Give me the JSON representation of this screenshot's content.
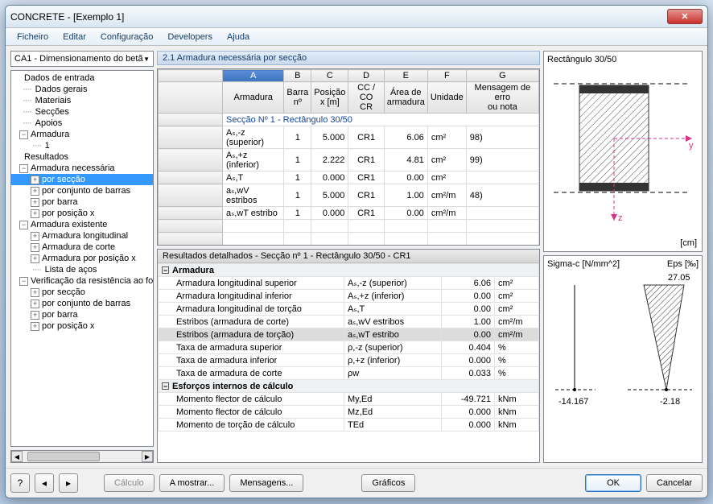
{
  "window_title": "CONCRETE - [Exemplo 1]",
  "menu": [
    "Ficheiro",
    "Editar",
    "Configuração",
    "Developers",
    "Ajuda"
  ],
  "dropdown": "CA1 - Dimensionamento do betã",
  "tree": {
    "n0": "Dados de entrada",
    "n1": "Dados gerais",
    "n2": "Materiais",
    "n3": "Secções",
    "n4": "Apoios",
    "n5": "Armadura",
    "n6": "1",
    "n7": "Resultados",
    "n8": "Armadura necessária",
    "n9": "por secção",
    "n10": "por conjunto de barras",
    "n11": "por barra",
    "n12": "por posição x",
    "n13": "Armadura existente",
    "n14": "Armadura longitudinal",
    "n15": "Armadura de corte",
    "n16": "Armadura por posição x",
    "n17": "Lista de aços",
    "n18": "Verificação da resistência ao fo",
    "n19": "por secção",
    "n20": "por conjunto de barras",
    "n21": "por barra",
    "n22": "por posição x"
  },
  "section_title": "2.1 Armadura necessária por secção",
  "cols": {
    "A": "A",
    "B": "B",
    "C": "C",
    "D": "D",
    "E": "E",
    "F": "F",
    "G": "G"
  },
  "heads": {
    "armadura": "Armadura",
    "barra": "Barra\nnº",
    "posx": "Posição\nx [m]",
    "ccco": "CC / CO\nCR",
    "area": "Área de\narmadura",
    "unid": "Unidade",
    "msg": "Mensagem de erro\nou nota"
  },
  "span_row": "Secção Nº 1 - Rectângulo 30/50",
  "grid_rows": [
    {
      "a": "Aₛ,-z (superior)",
      "b": "1",
      "c": "5.000",
      "d": "CR1",
      "e": "6.06",
      "f": "cm²",
      "g": "98)"
    },
    {
      "a": "Aₛ,+z (inferior)",
      "b": "1",
      "c": "2.222",
      "d": "CR1",
      "e": "4.81",
      "f": "cm²",
      "g": "99)"
    },
    {
      "a": "Aₛ,T",
      "b": "1",
      "c": "0.000",
      "d": "CR1",
      "e": "0.00",
      "f": "cm²",
      "g": ""
    },
    {
      "a": "aₛ,wV estribos",
      "b": "1",
      "c": "5.000",
      "d": "CR1",
      "e": "1.00",
      "f": "cm²/m",
      "g": "48)"
    },
    {
      "a": "aₛ,wT estribo",
      "b": "1",
      "c": "0.000",
      "d": "CR1",
      "e": "0.00",
      "f": "cm²/m",
      "g": ""
    }
  ],
  "detail_title": "Resultados detalhados  -  Secção nº 1 - Rectângulo 30/50  -  CR1",
  "detail": {
    "h1": "Armadura",
    "rows1": [
      {
        "l": "Armadura longitudinal superior",
        "s": "Aₛ,-z (superior)",
        "v": "6.06",
        "u": "cm²"
      },
      {
        "l": "Armadura longitudinal inferior",
        "s": "Aₛ,+z (inferior)",
        "v": "0.00",
        "u": "cm²"
      },
      {
        "l": "Armadura longitudinal de torção",
        "s": "Aₛ,T",
        "v": "0.00",
        "u": "cm²"
      },
      {
        "l": "Estribos (armadura de corte)",
        "s": "aₛ,wV estribos",
        "v": "1.00",
        "u": "cm²/m"
      },
      {
        "l": "Estribos (armadura de torção)",
        "s": "aₛ,wT estribo",
        "v": "0.00",
        "u": "cm²/m",
        "sel": true
      },
      {
        "l": "Taxa de armadura superior",
        "s": "ρ,-z (superior)",
        "v": "0.404",
        "u": "%"
      },
      {
        "l": "Taxa de armadura inferior",
        "s": "ρ,+z (inferior)",
        "v": "0.000",
        "u": "%"
      },
      {
        "l": "Taxa de armadura de corte",
        "s": "ρw",
        "v": "0.033",
        "u": "%"
      }
    ],
    "h2": "Esforços internos de cálculo",
    "rows2": [
      {
        "l": "Momento flector de cálculo",
        "s": "My,Ed",
        "v": "-49.721",
        "u": "kNm"
      },
      {
        "l": "Momento flector de cálculo",
        "s": "Mz,Ed",
        "v": "0.000",
        "u": "kNm"
      },
      {
        "l": "Momento de torção de cálculo",
        "s": "TEd",
        "v": "0.000",
        "u": "kNm"
      }
    ]
  },
  "preview": {
    "title": "Rectângulo 30/50",
    "unit": "[cm]",
    "y": "y",
    "z": "z"
  },
  "diagram": {
    "sigma": "Sigma-c [N/mm^2]",
    "eps": "Eps [‰]",
    "top": "27.05",
    "bl": "-14.167",
    "br": "-2.18"
  },
  "buttons": {
    "calc": "Cálculo",
    "mostrar": "A mostrar...",
    "msgs": "Mensagens...",
    "graf": "Gráficos",
    "ok": "OK",
    "cancel": "Cancelar"
  }
}
